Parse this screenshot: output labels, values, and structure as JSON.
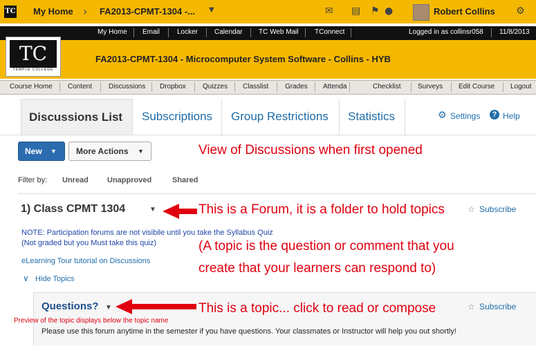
{
  "topbar": {
    "home": "My Home",
    "course": "FA2013-CPMT-1304 -...",
    "user": "Robert Collins"
  },
  "strip": {
    "links": [
      "My Home",
      "Email",
      "Locker",
      "Calendar",
      "TC Web Mail",
      "TConnect"
    ],
    "logged_in": "Logged in as collinsr058",
    "date": "11/8/2013"
  },
  "banner": {
    "logo": "TC",
    "logo_sub": "TEMPLE COLLEGE",
    "title": "FA2013-CPMT-1304 - Microcomputer System Software - Collins - HYB"
  },
  "nav": [
    "Course Home",
    "Content",
    "Discussions",
    "Dropbox",
    "Quizzes",
    "Classlist",
    "Grades",
    "Attenda",
    "Checklist",
    "Surveys",
    "Edit Course",
    "Logout"
  ],
  "tabs": [
    "Discussions List",
    "Subscriptions",
    "Group Restrictions",
    "Statistics"
  ],
  "header_links": {
    "settings": "Settings",
    "help": "Help"
  },
  "buttons": {
    "new": "New",
    "more": "More Actions"
  },
  "filter": {
    "label": "Filter by:",
    "options": [
      "Unread",
      "Unapproved",
      "Shared"
    ]
  },
  "forum": {
    "title": "1) Class CPMT 1304",
    "subscribe": "Subscribe",
    "note1": "NOTE: Participation forums are not visibile until you take the Syllabus Quiz",
    "note2": "(Not graded but you Must take this quiz)",
    "tour": "eLearning Tour tutorial on Discussions",
    "hide": "Hide Topics"
  },
  "topic": {
    "title": "Questions?",
    "subscribe": "Subscribe",
    "preview": "Please use this forum anytime in the semester if you have questions. Your classmates or Instructor will help you out shortly!"
  },
  "annotations": {
    "view": "View of Discussions when first opened",
    "forum": "This is a Forum, it is a folder to hold topics",
    "topic_def1": "(A topic is the question or comment that you",
    "topic_def2": "create that your learners can respond to)",
    "topic": "This is a topic... click to read or compose",
    "preview": "Preview of the topic displays below the topic name"
  },
  "colors": {
    "gold": "#f5b800",
    "annotation_red": "#e0000f",
    "link_blue": "#1f6ca8"
  }
}
